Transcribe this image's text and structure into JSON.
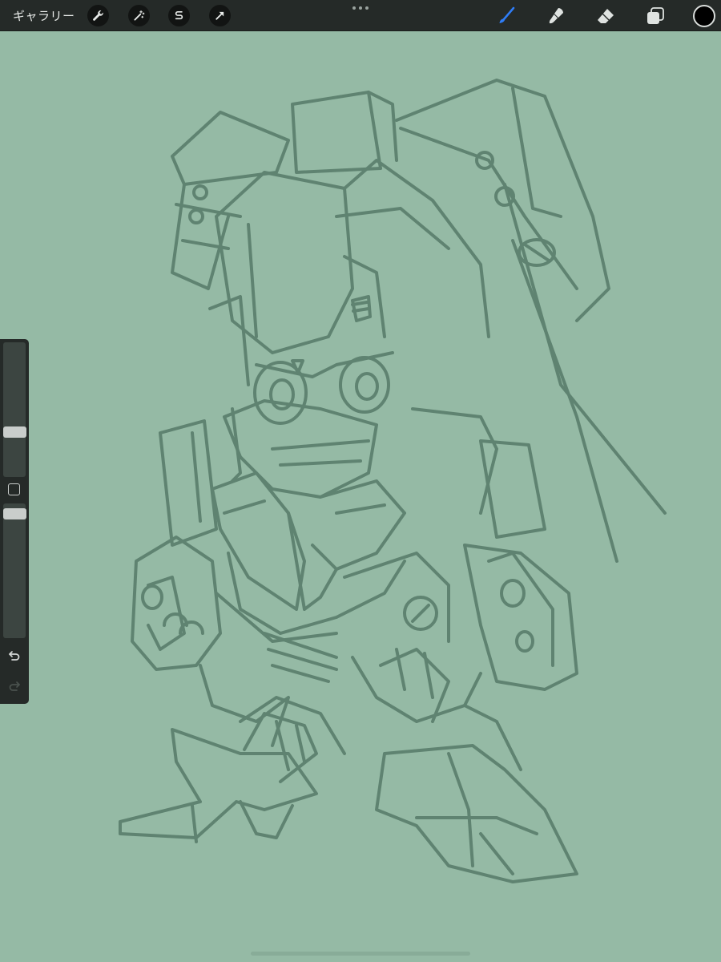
{
  "toolbar": {
    "gallery_label": "ギャラリー",
    "left_tools": [
      {
        "name": "actions",
        "icon": "wrench-icon"
      },
      {
        "name": "adjustments",
        "icon": "magic-wand-icon"
      },
      {
        "name": "selection",
        "icon": "selection-s-icon"
      },
      {
        "name": "transform",
        "icon": "transform-arrow-icon"
      }
    ],
    "right_tools": [
      {
        "name": "brush",
        "icon": "brush-icon",
        "active": true
      },
      {
        "name": "smudge",
        "icon": "smudge-icon",
        "active": false
      },
      {
        "name": "eraser",
        "icon": "eraser-icon",
        "active": false
      },
      {
        "name": "layers",
        "icon": "layers-icon",
        "active": false
      }
    ],
    "current_color": "#000000",
    "active_tool_color": "#2f7df6"
  },
  "sidebar": {
    "brush_size_level": 0.32,
    "opacity_level": 0.96
  },
  "canvas": {
    "background_color": "#95baa5",
    "stroke_color": "#5f8371"
  }
}
